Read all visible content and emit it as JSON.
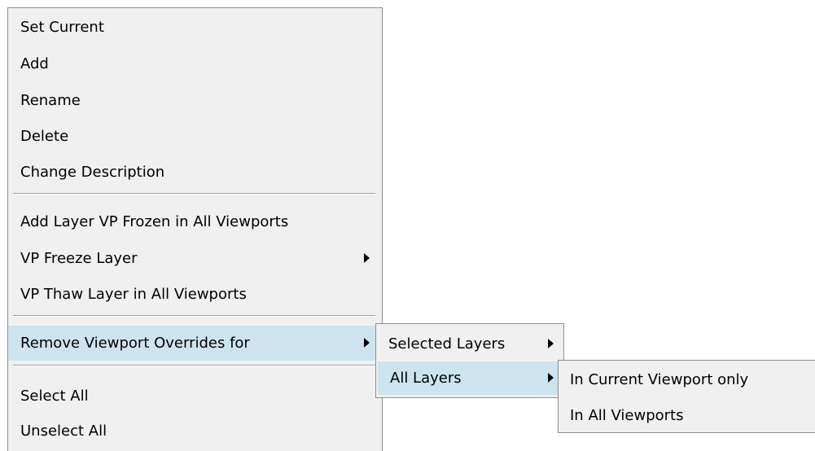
{
  "main_menu": {
    "items": [
      {
        "label": "Set Current"
      },
      {
        "label": "Add"
      },
      {
        "label": "Rename"
      },
      {
        "label": "Delete"
      },
      {
        "label": "Change Description"
      },
      {
        "label": "Add Layer VP Frozen in All Viewports"
      },
      {
        "label": "VP Freeze Layer",
        "has_submenu": true
      },
      {
        "label": "VP Thaw Layer in All Viewports"
      },
      {
        "label": "Remove Viewport Overrides for",
        "has_submenu": true,
        "highlighted": true
      },
      {
        "label": "Select All"
      },
      {
        "label": "Unselect All"
      }
    ]
  },
  "submenu_overrides": {
    "items": [
      {
        "label": "Selected Layers",
        "has_submenu": true
      },
      {
        "label": "All Layers",
        "has_submenu": true,
        "highlighted": true
      }
    ]
  },
  "submenu_all_layers": {
    "items": [
      {
        "label": "In Current Viewport only"
      },
      {
        "label": "In All Viewports"
      }
    ]
  },
  "colors": {
    "menu_background": "#f0f0f0",
    "highlight_background": "#cde4ee",
    "menu_border": "#8f8f8f",
    "text": "#000000"
  },
  "icons": {
    "submenu_arrow": "triangle-right-icon"
  }
}
